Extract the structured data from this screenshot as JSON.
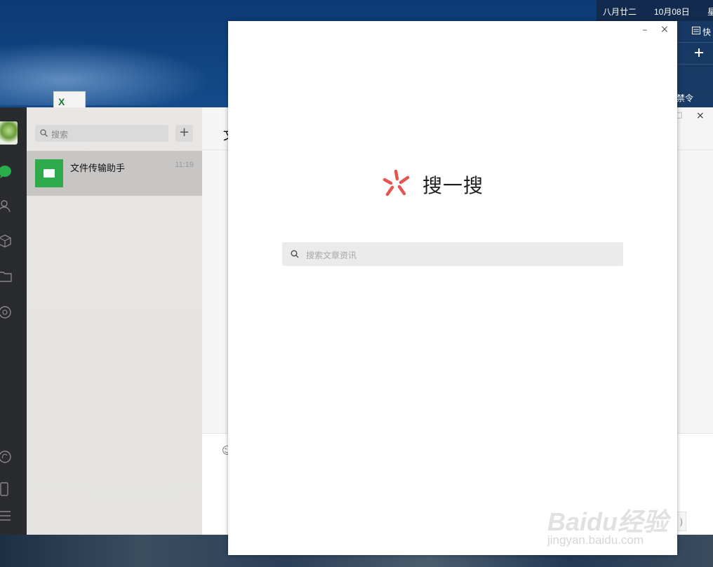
{
  "desktop": {
    "excel_icon_text": "X",
    "calendar": {
      "lunar": "八月廿二",
      "date": "10月08日",
      "weekday": "星"
    },
    "side_widget": {
      "quick": "快",
      "ban": "禁令"
    }
  },
  "wechat": {
    "search_placeholder": "搜索",
    "add_label": "+",
    "chat": {
      "name": "文件传输助手",
      "time": "11:19"
    },
    "chat_title": "文",
    "close": "×",
    "minimize_hint": "□",
    "send_label": ")"
  },
  "search_popup": {
    "title": "搜一搜",
    "placeholder": "搜索文章资讯",
    "minimize": "–",
    "close": "×",
    "logo_color": "#e4574f"
  },
  "watermark": {
    "brand": "Baidu经验",
    "url": "jingyan.baidu.com"
  }
}
